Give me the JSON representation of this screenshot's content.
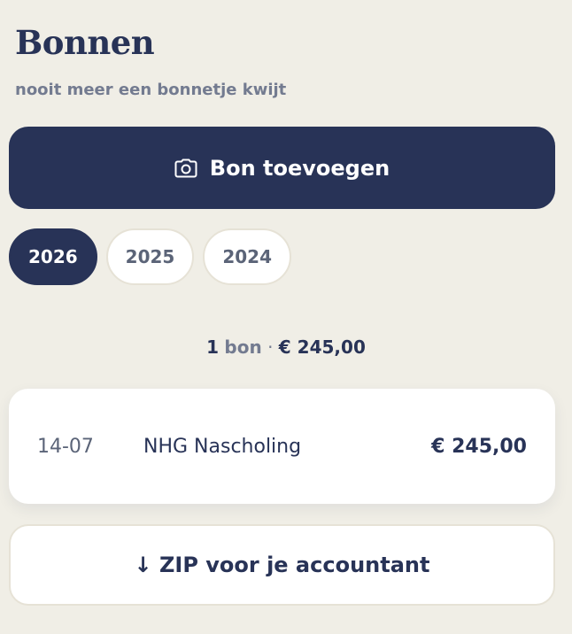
{
  "header": {
    "title": "Bonnen",
    "subtitle": "nooit meer een bonnetje kwijt"
  },
  "actions": {
    "add_label": "Bon toevoegen",
    "add_icon": "camera-icon",
    "zip_label": "↓ ZIP voor je accountant"
  },
  "years": [
    {
      "label": "2026",
      "active": true
    },
    {
      "label": "2025",
      "active": false
    },
    {
      "label": "2024",
      "active": false
    }
  ],
  "summary": {
    "count": "1",
    "word": "bon",
    "separator": "·",
    "total": "€ 245,00"
  },
  "receipts": [
    {
      "date": "14-07",
      "name": "NHG Nascholing",
      "amount": "€ 245,00"
    }
  ],
  "colors": {
    "background": "#f0eee6",
    "primary": "#283357",
    "muted": "#737b90",
    "card": "#ffffff",
    "border": "#e6e2d6"
  }
}
